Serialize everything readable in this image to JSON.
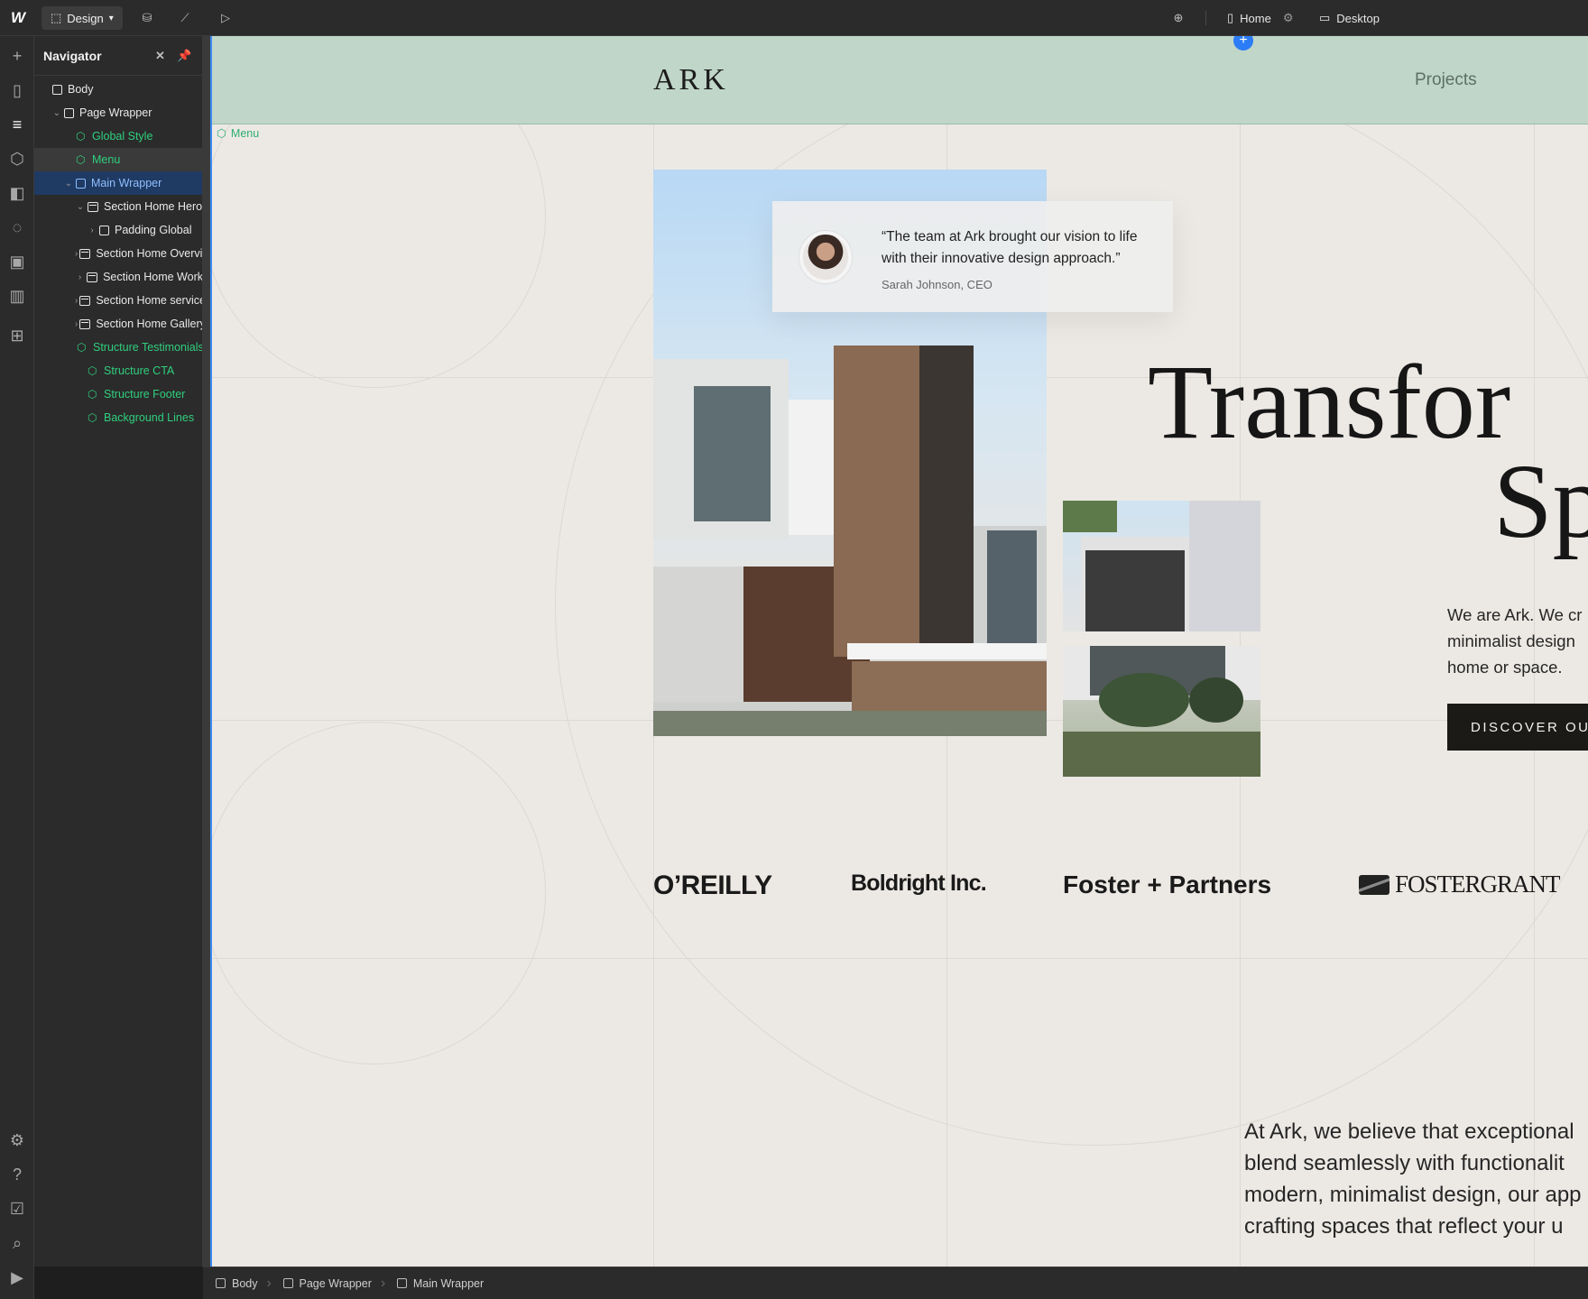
{
  "topbar": {
    "logo": "W",
    "mode_label": "Design",
    "page_label": "Home",
    "breakpoint_label": "Desktop"
  },
  "navigator": {
    "title": "Navigator",
    "items": [
      {
        "label": "Body",
        "type": "box",
        "indent": 0
      },
      {
        "label": "Page Wrapper",
        "type": "box",
        "indent": 1
      },
      {
        "label": "Global Style",
        "type": "component",
        "indent": 2
      },
      {
        "label": "Menu",
        "type": "component",
        "indent": 2
      },
      {
        "label": "Main Wrapper",
        "type": "box",
        "indent": 2
      },
      {
        "label": "Section Home Hero",
        "type": "section",
        "indent": 3
      },
      {
        "label": "Padding Global",
        "type": "box",
        "indent": 4
      },
      {
        "label": "Section Home Overview",
        "type": "section",
        "indent": 3
      },
      {
        "label": "Section Home Work",
        "type": "section",
        "indent": 3
      },
      {
        "label": "Section Home services",
        "type": "section",
        "indent": 3
      },
      {
        "label": "Section Home Gallery",
        "type": "section",
        "indent": 3
      },
      {
        "label": "Structure Testimonials",
        "type": "component",
        "indent": 3
      },
      {
        "label": "Structure CTA",
        "type": "component",
        "indent": 3
      },
      {
        "label": "Structure Footer",
        "type": "component",
        "indent": 3
      },
      {
        "label": "Background Lines",
        "type": "component",
        "indent": 3
      }
    ]
  },
  "site": {
    "logo": "ARK",
    "nav_projects": "Projects",
    "menu_tag": "Menu",
    "testimonial": {
      "quote": "“The team at Ark brought our vision to life with their innovative design approach.”",
      "author": "Sarah Johnson, CEO"
    },
    "hero_title_line1": "Transfor",
    "hero_title_line2": "Sp",
    "hero_paragraph_line1": "We are Ark. We cr",
    "hero_paragraph_line2": "minimalist design",
    "hero_paragraph_line3": "home or space.",
    "hero_button": "DISCOVER OUR",
    "logos": [
      "O’REILLY",
      "Boldright Inc.",
      "Foster + Partners",
      "FOSTERGRANT"
    ],
    "about_lines": [
      "At Ark, we believe that exceptional",
      "blend seamlessly with functionalit",
      "modern, minimalist design, our app",
      "crafting spaces that reflect your u"
    ]
  },
  "breadcrumb": [
    "Body",
    "Page Wrapper",
    "Main Wrapper"
  ],
  "colors": {
    "accent": "#2b7cf6",
    "component": "#2fcf7e",
    "header_bg": "#bfd6c8",
    "canvas_bg": "#ece9e4"
  }
}
